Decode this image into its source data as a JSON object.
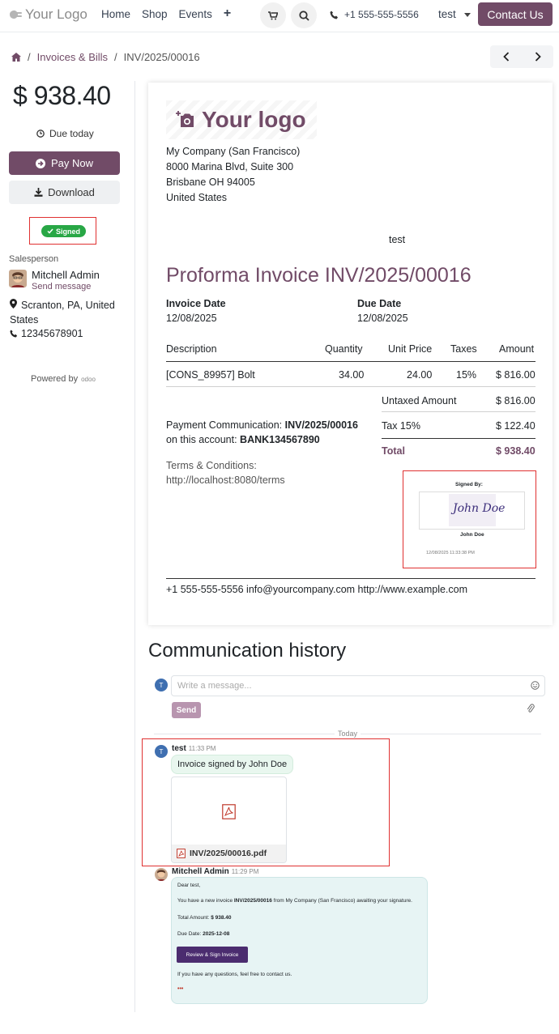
{
  "nav": {
    "logo_text": "Your Logo",
    "links": [
      "Home",
      "Shop",
      "Events"
    ],
    "add_symbol": "+",
    "phone": "+1 555-555-5556",
    "user": "test",
    "contact_label": "Contact Us"
  },
  "breadcrumb": {
    "items": [
      "Invoices & Bills",
      "INV/2025/00016"
    ],
    "separator": "/"
  },
  "sidebar": {
    "amount": "$ 938.40",
    "due_text": "Due today",
    "pay_label": "Pay Now",
    "download_label": "Download",
    "signed_badge": "Signed",
    "salesperson_label": "Salesperson",
    "salesperson_name": "Mitchell Admin",
    "send_message": "Send message",
    "address": "Scranton, PA, United States",
    "phone": "12345678901",
    "powered_by": "Powered by",
    "powered_brand": "odoo"
  },
  "invoice": {
    "logo_text": "Your logo",
    "company_lines": [
      "My Company (San Francisco)",
      "8000 Marina Blvd, Suite 300",
      "Brisbane OH 94005",
      "United States"
    ],
    "customer": "test",
    "title": "Proforma Invoice INV/2025/00016",
    "invoice_date_label": "Invoice Date",
    "invoice_date": "12/08/2025",
    "due_date_label": "Due Date",
    "due_date": "12/08/2025",
    "columns": {
      "description": "Description",
      "quantity": "Quantity",
      "unit_price": "Unit Price",
      "taxes": "Taxes",
      "amount": "Amount"
    },
    "line": {
      "description": "[CONS_89957] Bolt",
      "quantity": "34.00",
      "unit_price": "24.00",
      "taxes": "15%",
      "amount": "$ 816.00"
    },
    "untaxed_label": "Untaxed Amount",
    "untaxed_value": "$ 816.00",
    "tax_label": "Tax 15%",
    "tax_value": "$ 122.40",
    "total_label": "Total",
    "total_value": "$ 938.40",
    "payment_comm_prefix": "Payment Communication:",
    "payment_comm_ref": "INV/2025/00016",
    "account_prefix": "on this account:",
    "account": "BANK134567890",
    "terms_label": "Terms & Conditions:",
    "terms_url": "http://localhost:8080/terms",
    "signed_by_label": "Signed By:",
    "signature_script": "John Doe",
    "signer_name": "John Doe",
    "signed_timestamp": "12/08/2025 11:33:38 PM",
    "footer": "+1 555-555-5556 info@yourcompany.com http://www.example.com"
  },
  "communication": {
    "title": "Communication history",
    "placeholder": "Write a message...",
    "send_label": "Send",
    "today_label": "Today",
    "avatar_letter": "T",
    "messages": [
      {
        "author": "test",
        "time": "11:33 PM",
        "body": "Invoice signed by John Doe",
        "attachment": "INV/2025/00016.pdf"
      },
      {
        "author": "Mitchell Admin",
        "time": "11:29 PM",
        "greeting": "Dear test,",
        "line1_prefix": "You have a new invoice",
        "line1_ref": "INV/2025/00016",
        "line1_suffix": "from My Company (San Francisco) awaiting your signature.",
        "total_label": "Total Amount:",
        "total_value": "$ 938.40",
        "due_label": "Due Date:",
        "due_value": "2025-12-08",
        "button_label": "Review & Sign Invoice",
        "closing": "If you have any questions, feel free to contact us.",
        "more": "•••"
      }
    ]
  },
  "colors": {
    "brand": "#714B67",
    "success": "#28a745",
    "highlight_border": "#e03131"
  }
}
